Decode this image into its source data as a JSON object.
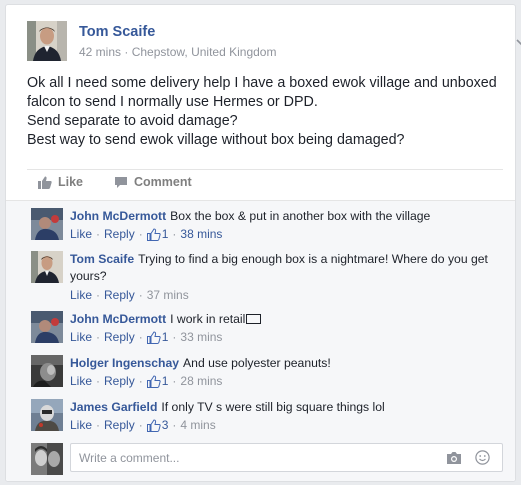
{
  "post": {
    "author": "Tom Scaife",
    "time": "42 mins",
    "location": "Chepstow, United Kingdom",
    "dot": "·",
    "menu_icon": "chevron-down-icon",
    "text_lines": [
      "Ok all I need some delivery help I have a boxed ewok village and unboxed",
      "falcon to send I normally use Hermes or DPD.",
      "Send separate to avoid damage?",
      "Best way to send ewok village without box being damaged?"
    ]
  },
  "actions": {
    "like_label": "Like",
    "comment_label": "Comment",
    "like_icon": "thumbs-up-icon",
    "comment_icon": "speech-bubble-icon"
  },
  "comments": [
    {
      "author": "John McDermott",
      "text": "Box the box & put in another box with the village",
      "like_label": "Like",
      "reply_label": "Reply",
      "likes": "1",
      "time": "38 mins"
    },
    {
      "author": "Tom Scaife",
      "text": "Trying to find a big enough box is a nightmare! Where do you get yours?",
      "like_label": "Like",
      "reply_label": "Reply",
      "likes": "",
      "time": "37 mins"
    },
    {
      "author": "John McDermott",
      "text": "I work in retail",
      "like_label": "Like",
      "reply_label": "Reply",
      "likes": "1",
      "time": "33 mins"
    },
    {
      "author": "Holger Ingenschay",
      "text": "And use polyester peanuts!",
      "like_label": "Like",
      "reply_label": "Reply",
      "likes": "1",
      "time": "28 mins"
    },
    {
      "author": "James Garfield",
      "text": "If only TV s were still big square things lol",
      "like_label": "Like",
      "reply_label": "Reply",
      "likes": "3",
      "time": "4 mins"
    }
  ],
  "composer": {
    "placeholder": "Write a comment...",
    "camera_icon": "camera-icon",
    "emoji_icon": "smiley-icon"
  },
  "colors": {
    "link": "#365899",
    "meta": "#90949c",
    "text": "#1d2129",
    "comments_bg": "#f6f7f9"
  }
}
